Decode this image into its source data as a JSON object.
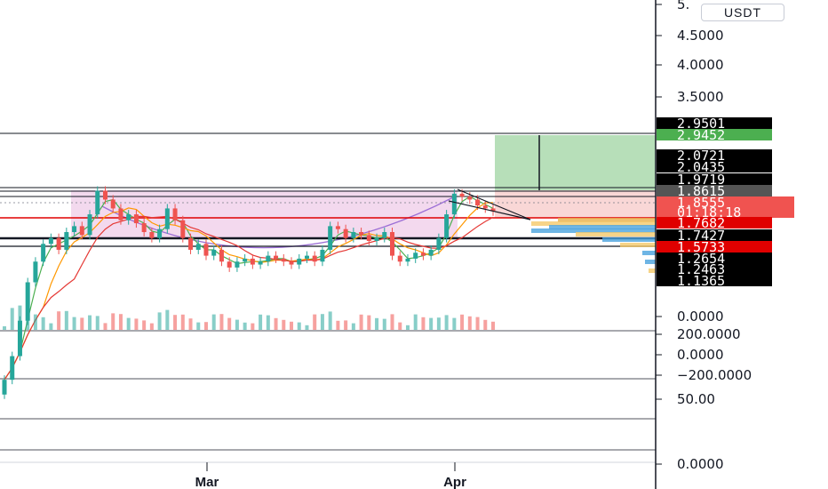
{
  "chart_data": {
    "type": "candlestick",
    "currency": "USDT",
    "x_labels": [
      "Mar",
      "Apr"
    ],
    "price_axis_ticks": [
      "5.",
      "4.5000",
      "4.0000",
      "3.5000"
    ],
    "price_tags": [
      {
        "label": "2.9501",
        "color": "#000000"
      },
      {
        "label": "2.9452",
        "color": "#4caf50"
      },
      {
        "label": "2.0721",
        "color": "#000000"
      },
      {
        "label": "2.0435",
        "color": "#000000"
      },
      {
        "label": "1.9719",
        "color": "#000000"
      },
      {
        "label": "1.8615",
        "color": "#555555"
      },
      {
        "label": "1.8555",
        "color": "#f05350"
      },
      {
        "label": "1.7682",
        "color": "#e00000"
      },
      {
        "label": "1.7427",
        "color": "#000000"
      },
      {
        "label": "1.5733",
        "color": "#e00000"
      },
      {
        "label": "1.2654",
        "color": "#000000"
      },
      {
        "label": "1.2463",
        "color": "#000000"
      },
      {
        "label": "1.1365",
        "color": "#000000"
      }
    ],
    "countdown": "01:18:18",
    "pane_axes": [
      {
        "pane": "volume",
        "ticks": [
          "0.0000"
        ]
      },
      {
        "pane": "oscillator",
        "ticks": [
          "200.0000",
          "0.0000",
          "−200.0000"
        ]
      },
      {
        "pane": "rsi",
        "ticks": [
          "50.00"
        ]
      },
      {
        "pane": "bottom",
        "ticks": [
          "0.0000"
        ]
      }
    ],
    "series_close": [
      1.22,
      1.3,
      1.42,
      1.55,
      1.62,
      1.68,
      1.7,
      1.66,
      1.72,
      1.74,
      1.71,
      1.78,
      1.86,
      1.83,
      1.8,
      1.76,
      1.78,
      1.75,
      1.72,
      1.7,
      1.73,
      1.8,
      1.76,
      1.7,
      1.66,
      1.68,
      1.64,
      1.66,
      1.62,
      1.6,
      1.62,
      1.63,
      1.61,
      1.62,
      1.64,
      1.63,
      1.62,
      1.61,
      1.63,
      1.64,
      1.62,
      1.66,
      1.74,
      1.73,
      1.7,
      1.72,
      1.71,
      1.69,
      1.7,
      1.72,
      1.64,
      1.62,
      1.63,
      1.65,
      1.64,
      1.66,
      1.7,
      1.78,
      1.85,
      1.84,
      1.83,
      1.81,
      1.8,
      1.79
    ]
  }
}
